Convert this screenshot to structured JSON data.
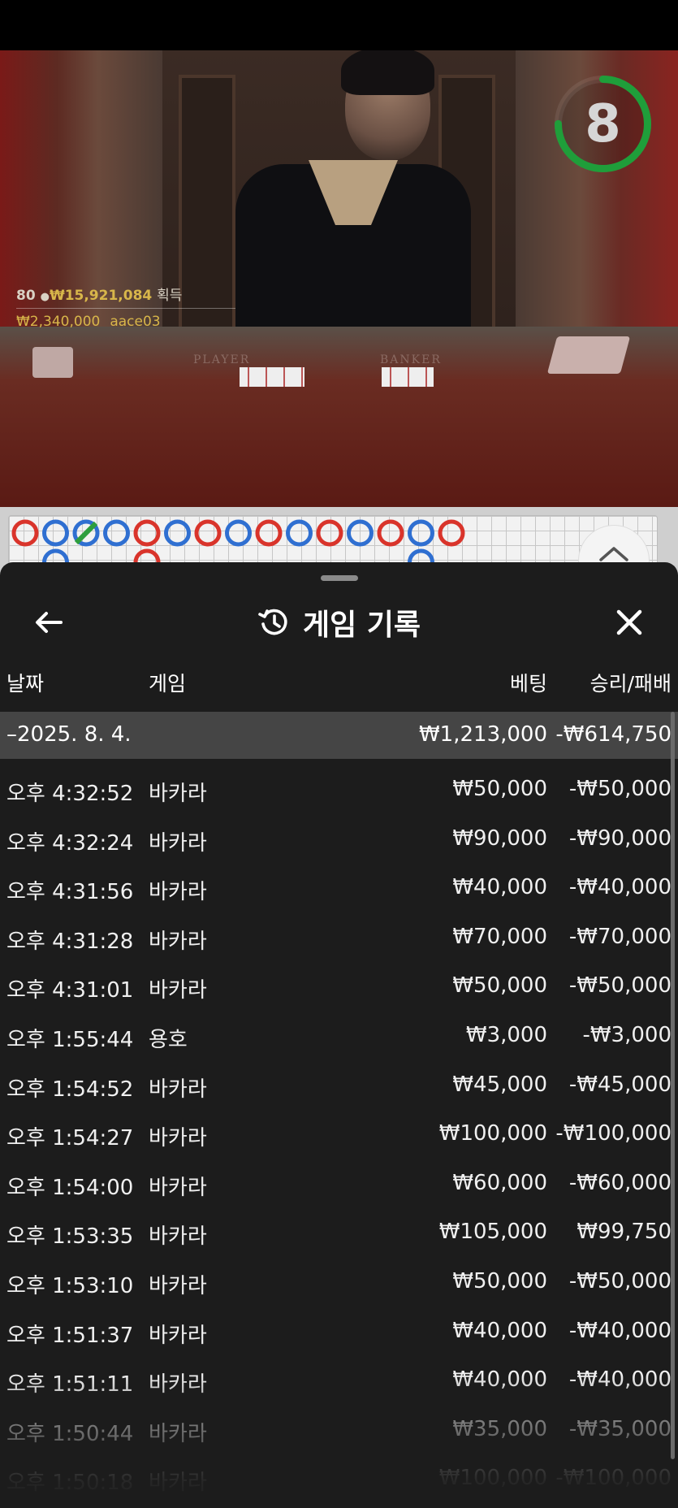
{
  "video": {
    "win_count": "80",
    "win_amount": "₩15,921,084",
    "win_suffix": "획득",
    "winner_amount": "₩2,340,000",
    "winner_name": "aace03",
    "table_player_label": "PLAYER",
    "table_banker_label": "BANKER",
    "timer_value": "8",
    "timer_progress": 0.75,
    "timer_color": "#1f9e3a"
  },
  "sheet": {
    "title": "게임 기록",
    "back_icon": "arrow-left-icon",
    "history_icon": "history-icon",
    "close_icon": "close-icon",
    "columns": {
      "date": "날짜",
      "game": "게임",
      "bet": "베팅",
      "result": "승리/패배"
    },
    "date_group": {
      "date": "–2025. 8. 4.",
      "total_bet": "₩1,213,000",
      "total_result": "-₩614,750"
    },
    "rows": [
      {
        "time": "오후 4:32:52",
        "game": "바카라",
        "bet": "₩50,000",
        "result": "-₩50,000"
      },
      {
        "time": "오후 4:32:24",
        "game": "바카라",
        "bet": "₩90,000",
        "result": "-₩90,000"
      },
      {
        "time": "오후 4:31:56",
        "game": "바카라",
        "bet": "₩40,000",
        "result": "-₩40,000"
      },
      {
        "time": "오후 4:31:28",
        "game": "바카라",
        "bet": "₩70,000",
        "result": "-₩70,000"
      },
      {
        "time": "오후 4:31:01",
        "game": "바카라",
        "bet": "₩50,000",
        "result": "-₩50,000"
      },
      {
        "time": "오후 1:55:44",
        "game": "용호",
        "bet": "₩3,000",
        "result": "-₩3,000"
      },
      {
        "time": "오후 1:54:52",
        "game": "바카라",
        "bet": "₩45,000",
        "result": "-₩45,000"
      },
      {
        "time": "오후 1:54:27",
        "game": "바카라",
        "bet": "₩100,000",
        "result": "-₩100,000"
      },
      {
        "time": "오후 1:54:00",
        "game": "바카라",
        "bet": "₩60,000",
        "result": "-₩60,000"
      },
      {
        "time": "오후 1:53:35",
        "game": "바카라",
        "bet": "₩105,000",
        "result": "₩99,750"
      },
      {
        "time": "오후 1:53:10",
        "game": "바카라",
        "bet": "₩50,000",
        "result": "-₩50,000"
      },
      {
        "time": "오후 1:51:37",
        "game": "바카라",
        "bet": "₩40,000",
        "result": "-₩40,000"
      },
      {
        "time": "오후 1:51:11",
        "game": "바카라",
        "bet": "₩40,000",
        "result": "-₩40,000"
      },
      {
        "time": "오후 1:50:44",
        "game": "바카라",
        "bet": "₩35,000",
        "result": "-₩35,000"
      },
      {
        "time": "오후 1:50:18",
        "game": "바카라",
        "bet": "₩100,000",
        "result": "-₩100,000"
      }
    ]
  },
  "roadmap": {
    "top_row": [
      "B",
      "P",
      "T",
      "P",
      "B",
      "P",
      "B",
      "P",
      "B",
      "P",
      "B",
      "P",
      "B",
      "P",
      "B"
    ],
    "second_row": [
      "",
      "P",
      "",
      "",
      "B",
      "",
      "",
      "",
      "",
      "",
      "",
      "",
      "",
      "P",
      ""
    ],
    "colors": {
      "banker": "#d9342b",
      "player": "#2f6fd1",
      "tie": "#2e9e3e"
    }
  }
}
